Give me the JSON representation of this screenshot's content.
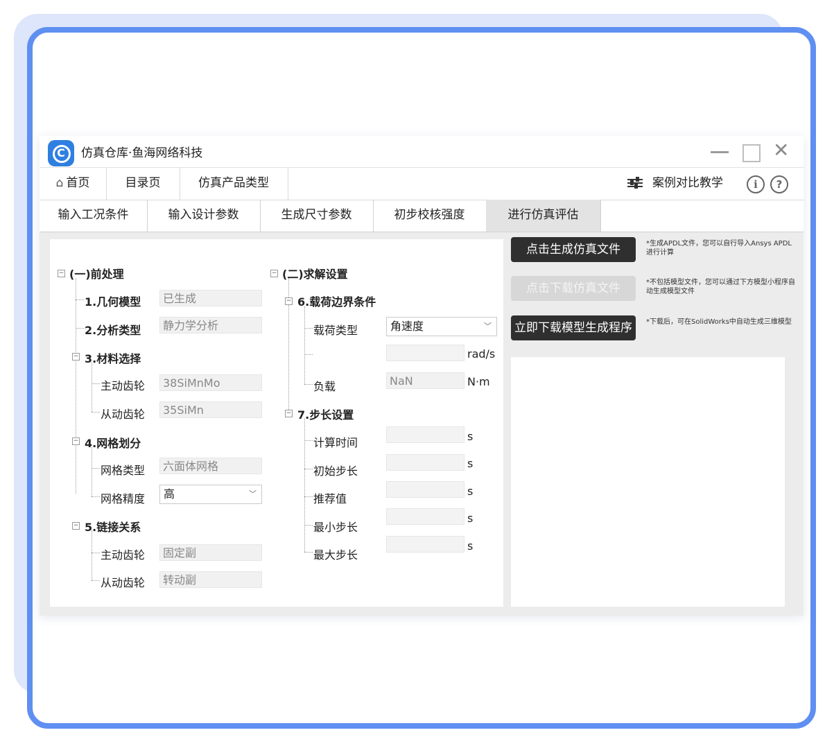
{
  "window": {
    "title": "仿真仓库·鱼海网络科技",
    "logo_letter": "C"
  },
  "navbar": {
    "home": "首页",
    "directory": "目录页",
    "product_types": "仿真产品类型",
    "compare": "案例对比教学",
    "info": "i",
    "help": "?"
  },
  "tabs": [
    "输入工况条件",
    "输入设计参数",
    "生成尺寸参数",
    "初步校核强度",
    "进行仿真评估"
  ],
  "active_tab": 4,
  "pre": {
    "title": "(一)前处理",
    "geometry": {
      "label": "1.几何模型",
      "value": "已生成"
    },
    "analysis": {
      "label": "2.分析类型",
      "value": "静力学分析"
    },
    "material": {
      "label": "3.材料选择",
      "driving": {
        "label": "主动齿轮",
        "value": "38SiMnMo"
      },
      "driven": {
        "label": "从动齿轮",
        "value": "35SiMn"
      }
    },
    "mesh": {
      "label": "4.网格划分",
      "type": {
        "label": "网格类型",
        "value": "六面体网格"
      },
      "precision": {
        "label": "网格精度",
        "value": "高"
      }
    },
    "link": {
      "label": "5.链接关系",
      "driving": {
        "label": "主动齿轮",
        "value": "固定副"
      },
      "driven": {
        "label": "从动齿轮",
        "value": "转动副"
      }
    }
  },
  "solve": {
    "title": "(二)求解设置",
    "load": {
      "label": "6.载荷边界条件",
      "type_label": "载荷类型",
      "type_value": "角速度",
      "value_unit": "rad/s",
      "load_label": "负载",
      "load_value": "NaN",
      "load_unit": "N·m"
    },
    "step": {
      "label": "7.步长设置",
      "unit": "s",
      "items": [
        "计算时间",
        "初始步长",
        "推荐值",
        "最小步长",
        "最大步长"
      ]
    }
  },
  "actions": {
    "generate": {
      "label": "点击生成仿真文件",
      "note": "*生成APDL文件，您可以自行导入Ansys APDL进行计算"
    },
    "download": {
      "label": "点击下载仿真文件",
      "note": "*不包括模型文件，您可以通过下方模型小程序自动生成模型文件"
    },
    "program": {
      "label": "立即下载模型生成程序",
      "note": "*下载后，可在SolidWorks中自动生成三维模型"
    }
  }
}
